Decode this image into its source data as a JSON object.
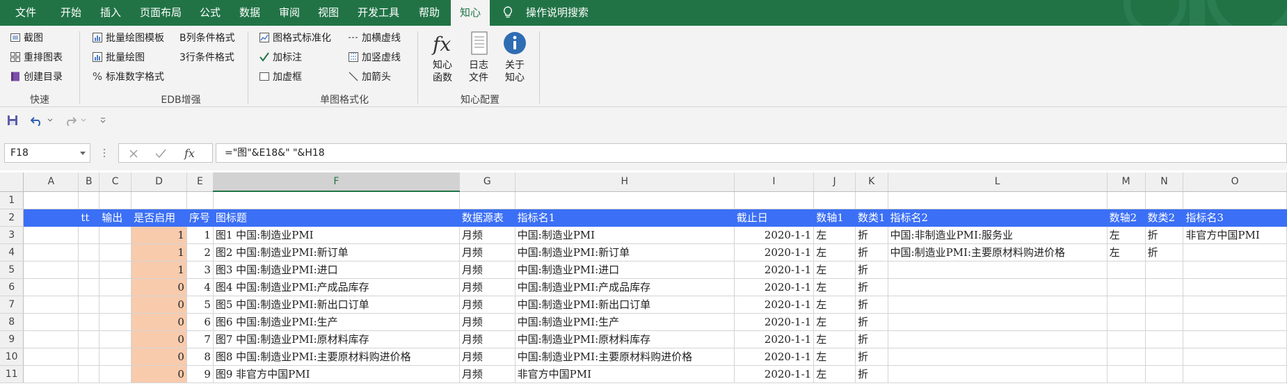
{
  "tabs": [
    "文件",
    "开始",
    "插入",
    "页面布局",
    "公式",
    "数据",
    "审阅",
    "视图",
    "开发工具",
    "帮助",
    "知心"
  ],
  "active_tab": "知心",
  "tell_me": "操作说明搜索",
  "ribbon": {
    "quick": {
      "label": "快速",
      "buttons": [
        "截图",
        "重排图表",
        "创建目录"
      ]
    },
    "edb": {
      "label": "EDB增强",
      "buttons": [
        "批量绘图模板",
        "B列条件格式",
        "批量绘图",
        "3行条件格式",
        "标准数字格式"
      ]
    },
    "format": {
      "label": "单图格式化",
      "buttons": [
        "图格式标准化",
        "加横虚线",
        "加标注",
        "加竖虚线",
        "加虚框",
        "加箭头"
      ]
    },
    "config": {
      "label": "知心配置",
      "buttons": [
        {
          "l1": "知心",
          "l2": "函数"
        },
        {
          "l1": "日志",
          "l2": "文件"
        },
        {
          "l1": "关于",
          "l2": "知心"
        }
      ]
    }
  },
  "namebox": "F18",
  "formula": "=\"图\"&E18&\" \"&H18",
  "columns": [
    "A",
    "B",
    "C",
    "D",
    "E",
    "F",
    "G",
    "H",
    "I",
    "J",
    "K",
    "L",
    "M",
    "N",
    "O"
  ],
  "rows": [
    {
      "n": "1",
      "cells": [
        "",
        "",
        "",
        "",
        "",
        "",
        "",
        "",
        "",
        "",
        "",
        "",
        "",
        "",
        ""
      ]
    },
    {
      "n": "2",
      "cells": [
        "",
        "tt",
        "输出",
        "是否启用",
        "序号",
        "图标题",
        "数据源表",
        "指标名1",
        "截止日",
        "数轴1",
        "数类1",
        "指标名2",
        "数轴2",
        "数类2",
        "指标名3"
      ]
    },
    {
      "n": "3",
      "cells": [
        "",
        "",
        "",
        "1",
        "1",
        "图1 中国:制造业PMI",
        "月频",
        "中国:制造业PMI",
        "2020-1-1",
        "左",
        "折",
        "中国:非制造业PMI:服务业",
        "左",
        "折",
        "非官方中国PMI"
      ]
    },
    {
      "n": "4",
      "cells": [
        "",
        "",
        "",
        "1",
        "2",
        "图2 中国:制造业PMI:新订单",
        "月频",
        "中国:制造业PMI:新订单",
        "2020-1-1",
        "左",
        "折",
        "中国:制造业PMI:主要原材料购进价格",
        "左",
        "折",
        ""
      ]
    },
    {
      "n": "5",
      "cells": [
        "",
        "",
        "",
        "1",
        "3",
        "图3 中国:制造业PMI:进口",
        "月频",
        "中国:制造业PMI:进口",
        "2020-1-1",
        "左",
        "折",
        "",
        "",
        "",
        ""
      ]
    },
    {
      "n": "6",
      "cells": [
        "",
        "",
        "",
        "0",
        "4",
        "图4 中国:制造业PMI:产成品库存",
        "月频",
        "中国:制造业PMI:产成品库存",
        "2020-1-1",
        "左",
        "折",
        "",
        "",
        "",
        ""
      ]
    },
    {
      "n": "7",
      "cells": [
        "",
        "",
        "",
        "0",
        "5",
        "图5 中国:制造业PMI:新出口订单",
        "月频",
        "中国:制造业PMI:新出口订单",
        "2020-1-1",
        "左",
        "折",
        "",
        "",
        "",
        ""
      ]
    },
    {
      "n": "8",
      "cells": [
        "",
        "",
        "",
        "0",
        "6",
        "图6 中国:制造业PMI:生产",
        "月频",
        "中国:制造业PMI:生产",
        "2020-1-1",
        "左",
        "折",
        "",
        "",
        "",
        ""
      ]
    },
    {
      "n": "9",
      "cells": [
        "",
        "",
        "",
        "0",
        "7",
        "图7 中国:制造业PMI:原材料库存",
        "月频",
        "中国:制造业PMI:原材料库存",
        "2020-1-1",
        "左",
        "折",
        "",
        "",
        "",
        ""
      ]
    },
    {
      "n": "10",
      "cells": [
        "",
        "",
        "",
        "0",
        "8",
        "图8 中国:制造业PMI:主要原材料购进价格",
        "月频",
        "中国:制造业PMI:主要原材料购进价格",
        "2020-1-1",
        "左",
        "折",
        "",
        "",
        "",
        ""
      ]
    },
    {
      "n": "11",
      "cells": [
        "",
        "",
        "",
        "0",
        "9",
        "图9 非官方中国PMI",
        "月频",
        "非官方中国PMI",
        "2020-1-1",
        "左",
        "折",
        "",
        "",
        "",
        ""
      ]
    }
  ]
}
